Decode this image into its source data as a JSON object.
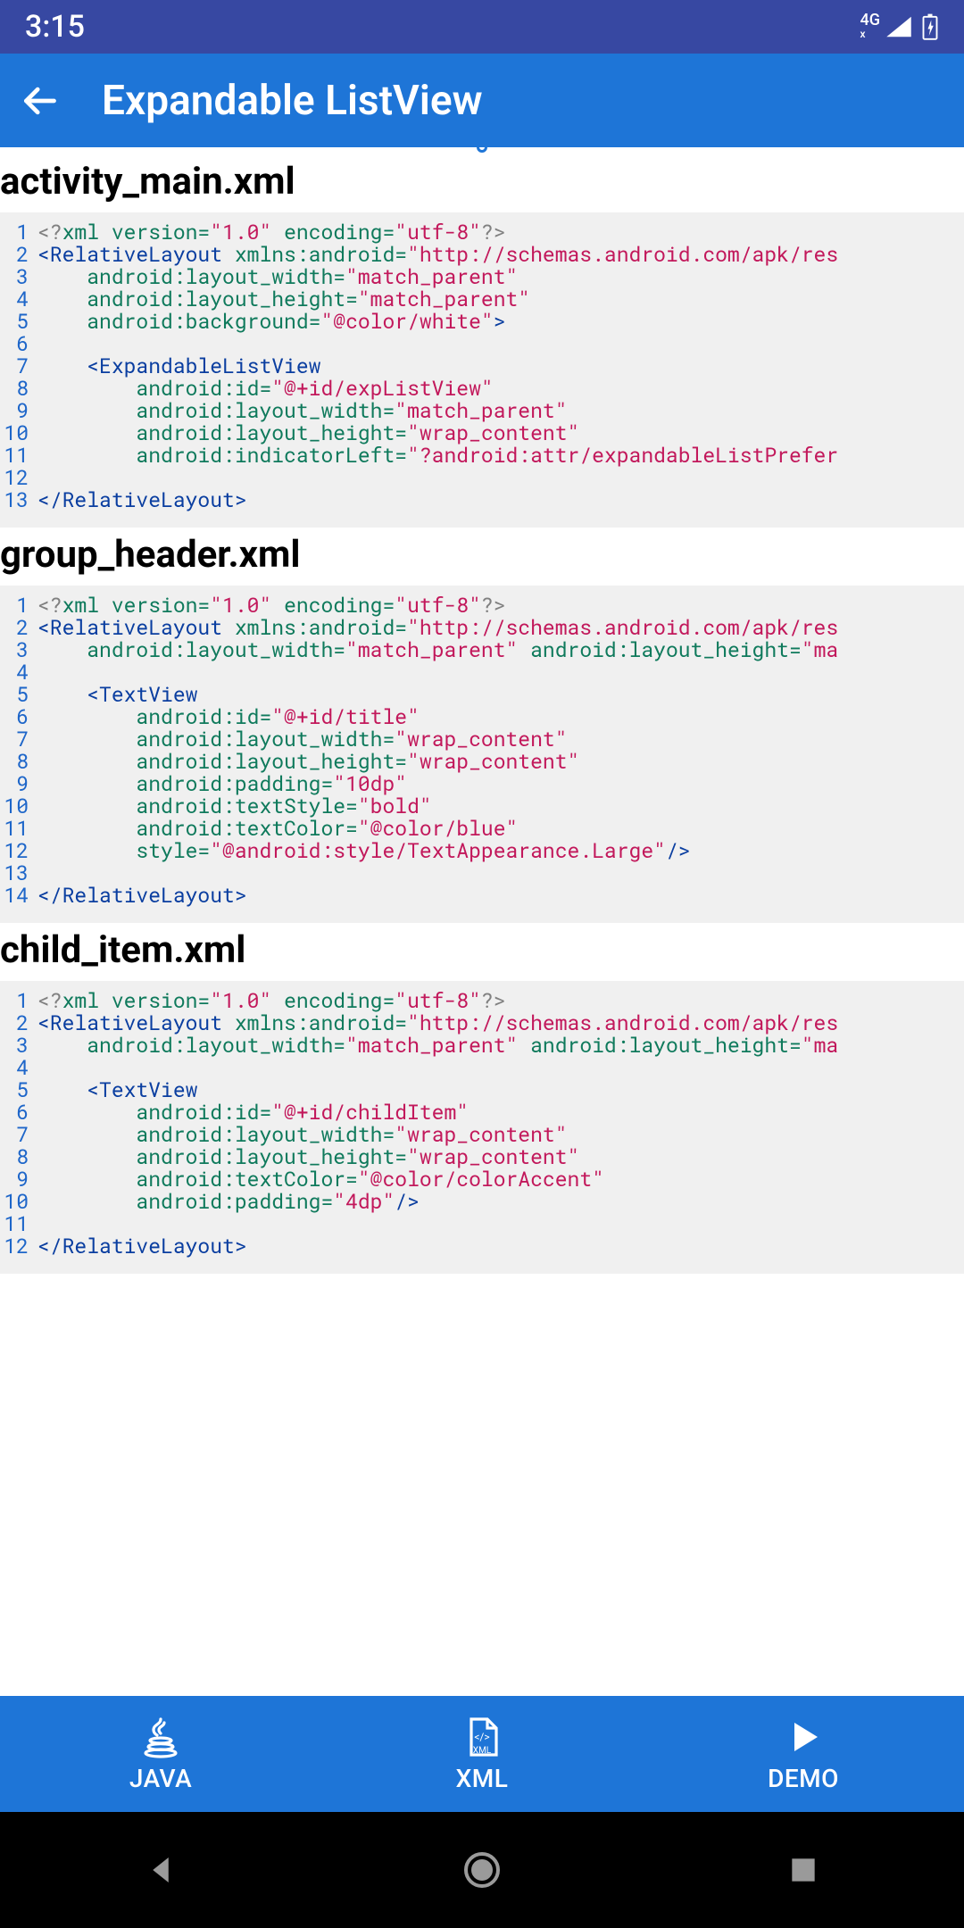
{
  "status": {
    "time": "3:15",
    "network": "4G"
  },
  "appbar": {
    "title": "Expandable ListView"
  },
  "files": [
    {
      "name": "activity_main.xml",
      "lines": [
        [
          {
            "c": "t-pi",
            "t": "<?"
          },
          {
            "c": "t-attr",
            "t": "xml version="
          },
          {
            "c": "t-str",
            "t": "\"1.0\""
          },
          {
            "c": "t-attr",
            "t": " encoding="
          },
          {
            "c": "t-str",
            "t": "\"utf-8\""
          },
          {
            "c": "t-pi",
            "t": "?>"
          }
        ],
        [
          {
            "c": "t-tag",
            "t": "<RelativeLayout "
          },
          {
            "c": "t-attr",
            "t": "xmlns:android="
          },
          {
            "c": "t-str",
            "t": "\"http://schemas.android.com/apk/res"
          }
        ],
        [
          {
            "c": "t-text",
            "t": "    "
          },
          {
            "c": "t-attr",
            "t": "android:layout_width="
          },
          {
            "c": "t-str",
            "t": "\"match_parent\""
          }
        ],
        [
          {
            "c": "t-text",
            "t": "    "
          },
          {
            "c": "t-attr",
            "t": "android:layout_height="
          },
          {
            "c": "t-str",
            "t": "\"match_parent\""
          }
        ],
        [
          {
            "c": "t-text",
            "t": "    "
          },
          {
            "c": "t-attr",
            "t": "android:background="
          },
          {
            "c": "t-str",
            "t": "\"@color/white\""
          },
          {
            "c": "t-tag",
            "t": ">"
          }
        ],
        [
          {
            "c": "t-text",
            "t": " "
          }
        ],
        [
          {
            "c": "t-text",
            "t": "    "
          },
          {
            "c": "t-tag",
            "t": "<ExpandableListView"
          }
        ],
        [
          {
            "c": "t-text",
            "t": "        "
          },
          {
            "c": "t-attr",
            "t": "android:id="
          },
          {
            "c": "t-str",
            "t": "\"@+id/expListView\""
          }
        ],
        [
          {
            "c": "t-text",
            "t": "        "
          },
          {
            "c": "t-attr",
            "t": "android:layout_width="
          },
          {
            "c": "t-str",
            "t": "\"match_parent\""
          }
        ],
        [
          {
            "c": "t-text",
            "t": "        "
          },
          {
            "c": "t-attr",
            "t": "android:layout_height="
          },
          {
            "c": "t-str",
            "t": "\"wrap_content\""
          }
        ],
        [
          {
            "c": "t-text",
            "t": "        "
          },
          {
            "c": "t-attr",
            "t": "android:indicatorLeft="
          },
          {
            "c": "t-str",
            "t": "\"?android:attr/expandableListPrefer"
          }
        ],
        [
          {
            "c": "t-text",
            "t": " "
          }
        ],
        [
          {
            "c": "t-tag",
            "t": "</RelativeLayout>"
          }
        ]
      ]
    },
    {
      "name": "group_header.xml",
      "lines": [
        [
          {
            "c": "t-pi",
            "t": "<?"
          },
          {
            "c": "t-attr",
            "t": "xml version="
          },
          {
            "c": "t-str",
            "t": "\"1.0\""
          },
          {
            "c": "t-attr",
            "t": " encoding="
          },
          {
            "c": "t-str",
            "t": "\"utf-8\""
          },
          {
            "c": "t-pi",
            "t": "?>"
          }
        ],
        [
          {
            "c": "t-tag",
            "t": "<RelativeLayout "
          },
          {
            "c": "t-attr",
            "t": "xmlns:android="
          },
          {
            "c": "t-str",
            "t": "\"http://schemas.android.com/apk/res"
          }
        ],
        [
          {
            "c": "t-text",
            "t": "    "
          },
          {
            "c": "t-attr",
            "t": "android:layout_width="
          },
          {
            "c": "t-str",
            "t": "\"match_parent\""
          },
          {
            "c": "t-attr",
            "t": " android:layout_height="
          },
          {
            "c": "t-str",
            "t": "\"ma"
          }
        ],
        [
          {
            "c": "t-text",
            "t": " "
          }
        ],
        [
          {
            "c": "t-text",
            "t": "    "
          },
          {
            "c": "t-tag",
            "t": "<TextView"
          }
        ],
        [
          {
            "c": "t-text",
            "t": "        "
          },
          {
            "c": "t-attr",
            "t": "android:id="
          },
          {
            "c": "t-str",
            "t": "\"@+id/title\""
          }
        ],
        [
          {
            "c": "t-text",
            "t": "        "
          },
          {
            "c": "t-attr",
            "t": "android:layout_width="
          },
          {
            "c": "t-str",
            "t": "\"wrap_content\""
          }
        ],
        [
          {
            "c": "t-text",
            "t": "        "
          },
          {
            "c": "t-attr",
            "t": "android:layout_height="
          },
          {
            "c": "t-str",
            "t": "\"wrap_content\""
          }
        ],
        [
          {
            "c": "t-text",
            "t": "        "
          },
          {
            "c": "t-attr",
            "t": "android:padding="
          },
          {
            "c": "t-str",
            "t": "\"10dp\""
          }
        ],
        [
          {
            "c": "t-text",
            "t": "        "
          },
          {
            "c": "t-attr",
            "t": "android:textStyle="
          },
          {
            "c": "t-str",
            "t": "\"bold\""
          }
        ],
        [
          {
            "c": "t-text",
            "t": "        "
          },
          {
            "c": "t-attr",
            "t": "android:textColor="
          },
          {
            "c": "t-str",
            "t": "\"@color/blue\""
          }
        ],
        [
          {
            "c": "t-text",
            "t": "        "
          },
          {
            "c": "t-attr",
            "t": "style="
          },
          {
            "c": "t-str",
            "t": "\"@android:style/TextAppearance.Large\""
          },
          {
            "c": "t-tag",
            "t": "/>"
          }
        ],
        [
          {
            "c": "t-text",
            "t": " "
          }
        ],
        [
          {
            "c": "t-tag",
            "t": "</RelativeLayout>"
          }
        ]
      ]
    },
    {
      "name": "child_item.xml",
      "lines": [
        [
          {
            "c": "t-pi",
            "t": "<?"
          },
          {
            "c": "t-attr",
            "t": "xml version="
          },
          {
            "c": "t-str",
            "t": "\"1.0\""
          },
          {
            "c": "t-attr",
            "t": " encoding="
          },
          {
            "c": "t-str",
            "t": "\"utf-8\""
          },
          {
            "c": "t-pi",
            "t": "?>"
          }
        ],
        [
          {
            "c": "t-tag",
            "t": "<RelativeLayout "
          },
          {
            "c": "t-attr",
            "t": "xmlns:android="
          },
          {
            "c": "t-str",
            "t": "\"http://schemas.android.com/apk/res"
          }
        ],
        [
          {
            "c": "t-text",
            "t": "    "
          },
          {
            "c": "t-attr",
            "t": "android:layout_width="
          },
          {
            "c": "t-str",
            "t": "\"match_parent\""
          },
          {
            "c": "t-attr",
            "t": " android:layout_height="
          },
          {
            "c": "t-str",
            "t": "\"ma"
          }
        ],
        [
          {
            "c": "t-text",
            "t": " "
          }
        ],
        [
          {
            "c": "t-text",
            "t": "    "
          },
          {
            "c": "t-tag",
            "t": "<TextView"
          }
        ],
        [
          {
            "c": "t-text",
            "t": "        "
          },
          {
            "c": "t-attr",
            "t": "android:id="
          },
          {
            "c": "t-str",
            "t": "\"@+id/childItem\""
          }
        ],
        [
          {
            "c": "t-text",
            "t": "        "
          },
          {
            "c": "t-attr",
            "t": "android:layout_width="
          },
          {
            "c": "t-str",
            "t": "\"wrap_content\""
          }
        ],
        [
          {
            "c": "t-text",
            "t": "        "
          },
          {
            "c": "t-attr",
            "t": "android:layout_height="
          },
          {
            "c": "t-str",
            "t": "\"wrap_content\""
          }
        ],
        [
          {
            "c": "t-text",
            "t": "        "
          },
          {
            "c": "t-attr",
            "t": "android:textColor="
          },
          {
            "c": "t-str",
            "t": "\"@color/colorAccent\""
          }
        ],
        [
          {
            "c": "t-text",
            "t": "        "
          },
          {
            "c": "t-attr",
            "t": "android:padding="
          },
          {
            "c": "t-str",
            "t": "\"4dp\""
          },
          {
            "c": "t-tag",
            "t": "/>"
          }
        ],
        [
          {
            "c": "t-text",
            "t": " "
          }
        ],
        [
          {
            "c": "t-tag",
            "t": "</RelativeLayout>"
          }
        ]
      ]
    }
  ],
  "tabs": {
    "java": "JAVA",
    "xml": "XML",
    "demo": "DEMO"
  }
}
